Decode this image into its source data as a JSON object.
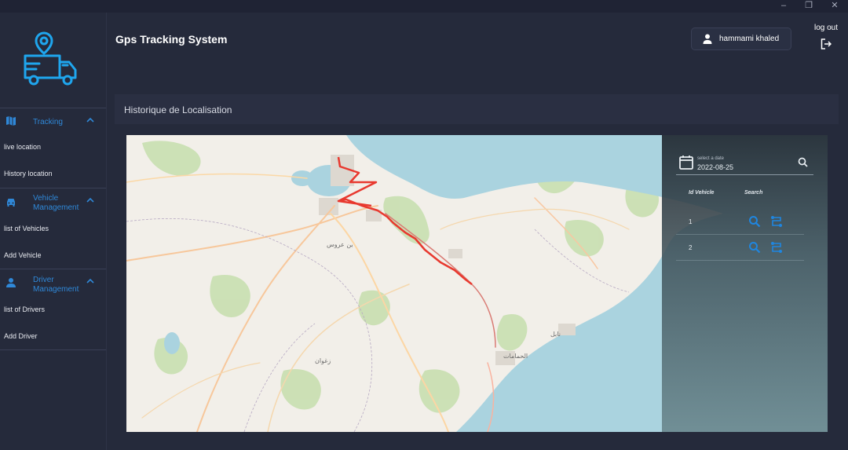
{
  "window": {
    "min": "–",
    "max": "❐",
    "close": "✕"
  },
  "header": {
    "title": "Gps Tracking System",
    "user_name": "hammami khaled",
    "logout_label": "log out"
  },
  "sidebar": {
    "tracking": {
      "label": "Tracking",
      "items": [
        "live location",
        "History location"
      ]
    },
    "vehicle": {
      "label_line1": "Vehicle",
      "label_line2": "Management",
      "items": [
        "list of Vehicles",
        "Add Vehicle"
      ]
    },
    "driver": {
      "label_line1": "Driver",
      "label_line2": "Management",
      "items": [
        "list of Drivers",
        "Add Driver"
      ]
    }
  },
  "section": {
    "title": "Historique de Localisation"
  },
  "history_panel": {
    "date_label": "select a date",
    "date_value": "2022-08-25",
    "columns": [
      "Id Vehicle",
      "Search"
    ],
    "rows": [
      {
        "id": "1"
      },
      {
        "id": "2"
      }
    ]
  },
  "map_labels": {
    "city_1": "الحمامات",
    "city_2": "نابل",
    "city_3": "بن عروس",
    "city_4": "زغوان"
  },
  "colors": {
    "accent": "#2f88d8",
    "route": "#e8392f",
    "sea": "#aad3df",
    "sidebar_bg": "#252a3b"
  }
}
